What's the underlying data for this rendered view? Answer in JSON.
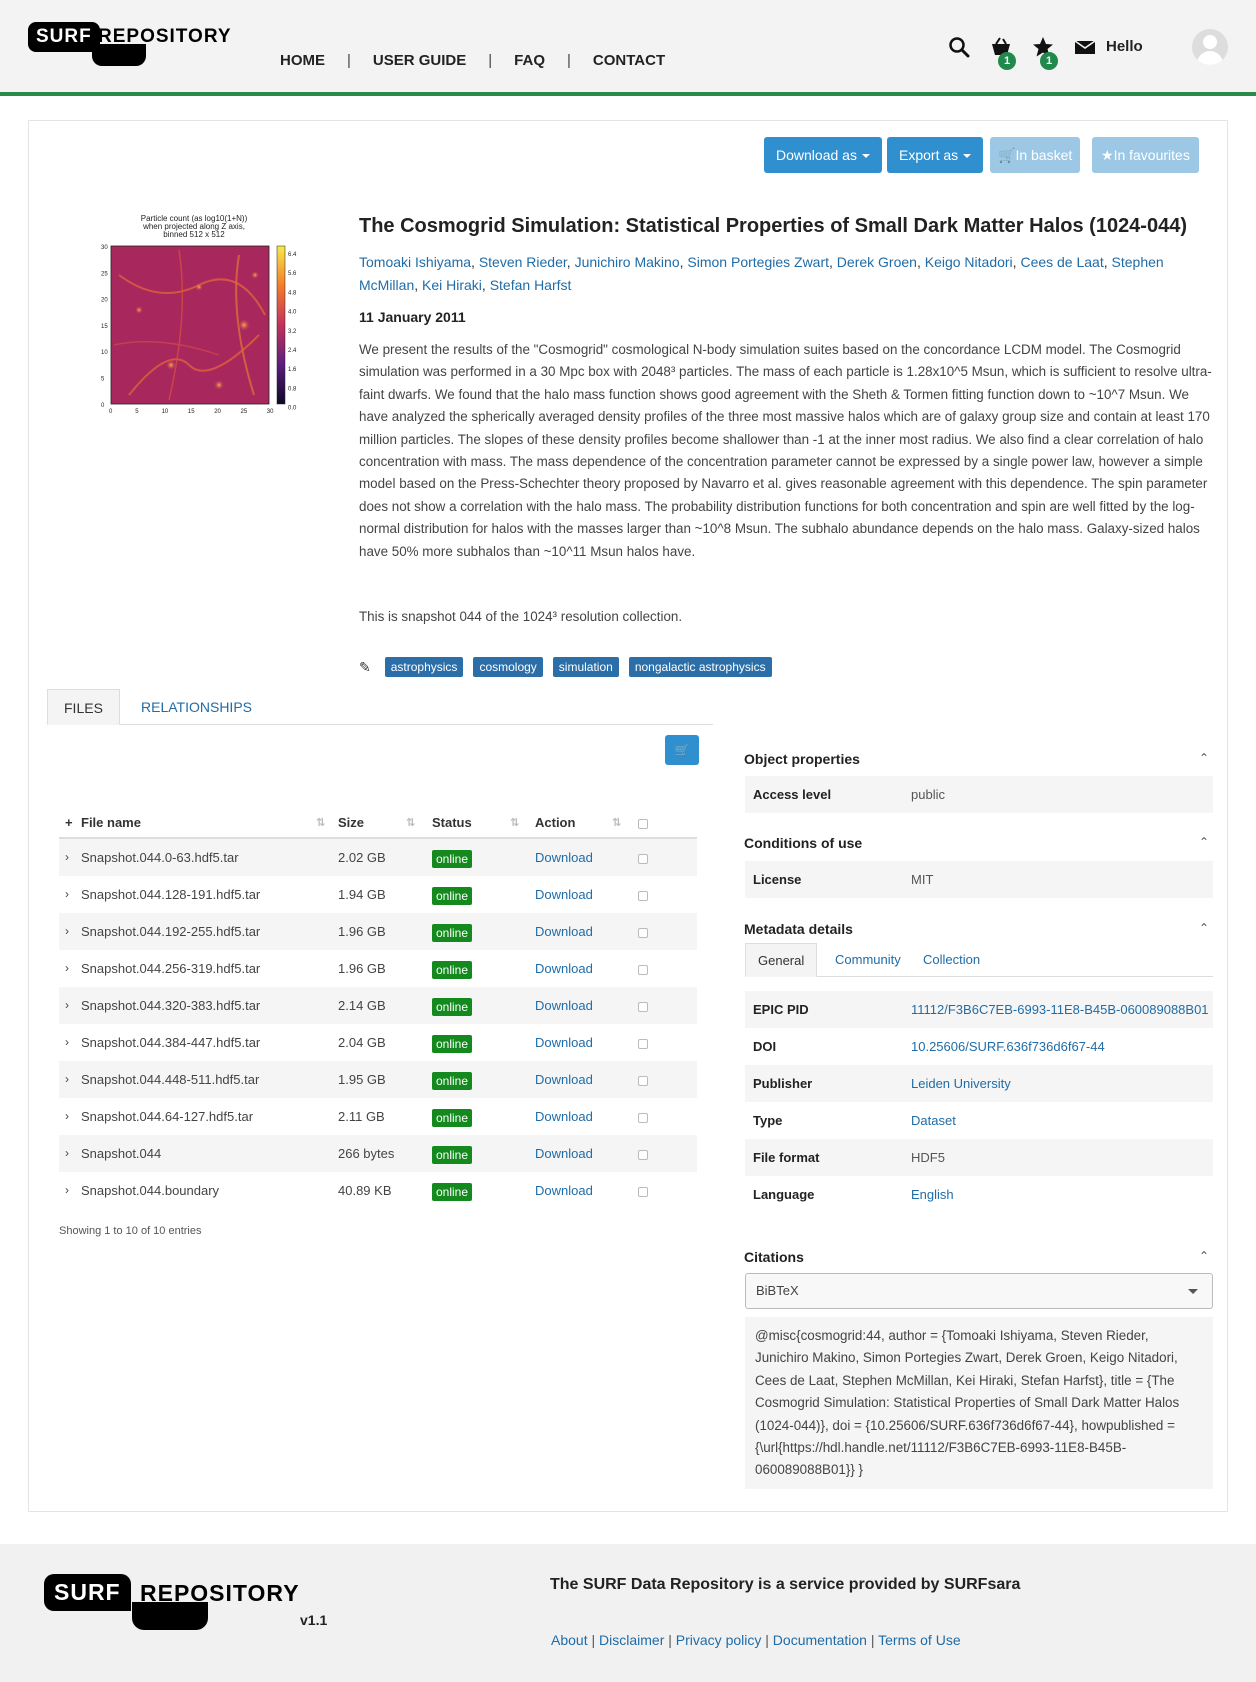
{
  "header": {
    "logo_surf": "SURF",
    "logo_repository": "REPOSITORY",
    "nav": [
      "HOME",
      "USER GUIDE",
      "FAQ",
      "CONTACT"
    ],
    "basket_count": "1",
    "favourites_count": "1",
    "greeting": "Hello"
  },
  "toolbar": {
    "download_as": "Download as",
    "export_as": "Export as",
    "in_basket": "In basket",
    "in_favourites": "In favourites"
  },
  "thumbnail": {
    "title_lines": [
      "Particle count (as log10(1+N))",
      "when projected along Z axis,",
      "binned 512 x 512"
    ],
    "y_ticks": [
      "30",
      "25",
      "20",
      "15",
      "10",
      "5",
      "0"
    ],
    "x_ticks": [
      "0",
      "5",
      "10",
      "15",
      "20",
      "25",
      "30"
    ],
    "colorbar_ticks": [
      "6.4",
      "5.6",
      "4.8",
      "4.0",
      "3.2",
      "2.4",
      "1.6",
      "0.8",
      "0.0"
    ]
  },
  "dataset": {
    "title": "The Cosmogrid Simulation: Statistical Properties of Small Dark Matter Halos (1024-044)",
    "authors": [
      "Tomoaki Ishiyama",
      "Steven Rieder",
      "Junichiro Makino",
      "Simon Portegies Zwart",
      "Derek Groen",
      "Keigo Nitadori",
      "Cees de Laat",
      "Stephen McMillan",
      "Kei Hiraki",
      "Stefan Harfst"
    ],
    "date": "11 January 2011",
    "abstract": "We present the results of the \"Cosmogrid\" cosmological N-body simulation suites based on the concordance LCDM model. The Cosmogrid simulation was performed in a 30 Mpc box with 2048³ particles. The mass of each particle is 1.28x10^5 Msun, which is sufficient to resolve ultra-faint dwarfs. We found that the halo mass function shows good agreement with the Sheth & Tormen fitting function down to ~10^7 Msun. We have analyzed the spherically averaged density profiles of the three most massive halos which are of galaxy group size and contain at least 170 million particles. The slopes of these density profiles become shallower than -1 at the inner most radius. We also find a clear correlation of halo concentration with mass. The mass dependence of the concentration parameter cannot be expressed by a single power law, however a simple model based on the Press-Schechter theory proposed by Navarro et al. gives reasonable agreement with this dependence. The spin parameter does not show a correlation with the halo mass. The probability distribution functions for both concentration and spin are well fitted by the log-normal distribution for halos with the masses larger than ~10^8 Msun. The subhalo abundance depends on the halo mass. Galaxy-sized halos have 50% more subhalos than ~10^11 Msun halos have.",
    "snapshot_note": "This is snapshot 044 of the 1024³ resolution collection.",
    "tags": [
      "astrophysics",
      "cosmology",
      "simulation",
      "nongalactic astrophysics"
    ]
  },
  "files_panel": {
    "tabs": [
      "FILES",
      "RELATIONSHIPS"
    ],
    "columns": {
      "name": "File name",
      "size": "Size",
      "status": "Status",
      "action": "Action"
    },
    "rows": [
      {
        "name": "Snapshot.044.0-63.hdf5.tar",
        "size": "2.02 GB",
        "status": "online",
        "action": "Download"
      },
      {
        "name": "Snapshot.044.128-191.hdf5.tar",
        "size": "1.94 GB",
        "status": "online",
        "action": "Download"
      },
      {
        "name": "Snapshot.044.192-255.hdf5.tar",
        "size": "1.96 GB",
        "status": "online",
        "action": "Download"
      },
      {
        "name": "Snapshot.044.256-319.hdf5.tar",
        "size": "1.96 GB",
        "status": "online",
        "action": "Download"
      },
      {
        "name": "Snapshot.044.320-383.hdf5.tar",
        "size": "2.14 GB",
        "status": "online",
        "action": "Download"
      },
      {
        "name": "Snapshot.044.384-447.hdf5.tar",
        "size": "2.04 GB",
        "status": "online",
        "action": "Download"
      },
      {
        "name": "Snapshot.044.448-511.hdf5.tar",
        "size": "1.95 GB",
        "status": "online",
        "action": "Download"
      },
      {
        "name": "Snapshot.044.64-127.hdf5.tar",
        "size": "2.11 GB",
        "status": "online",
        "action": "Download"
      },
      {
        "name": "Snapshot.044",
        "size": "266 bytes",
        "status": "online",
        "action": "Download"
      },
      {
        "name": "Snapshot.044.boundary",
        "size": "40.89 KB",
        "status": "online",
        "action": "Download"
      }
    ],
    "showing": "Showing 1 to 10 of 10 entries"
  },
  "object_properties": {
    "title": "Object properties",
    "access_level_label": "Access level",
    "access_level": "public"
  },
  "conditions": {
    "title": "Conditions of use",
    "license_label": "License",
    "license": "MIT"
  },
  "metadata": {
    "title": "Metadata details",
    "tabs": [
      "General",
      "Community",
      "Collection"
    ],
    "rows": [
      {
        "label": "EPIC PID",
        "value": "11112/F3B6C7EB-6993-11E8-B45B-060089088B01"
      },
      {
        "label": "DOI",
        "value": "10.25606/SURF.636f736d6f67-44"
      },
      {
        "label": "Publisher",
        "value": "Leiden University"
      },
      {
        "label": "Type",
        "value": "Dataset"
      },
      {
        "label": "File format",
        "value": "HDF5"
      },
      {
        "label": "Language",
        "value": "English"
      }
    ]
  },
  "citations": {
    "title": "Citations",
    "format": "BiBTeX",
    "text": "@misc{cosmogrid:44, author = {Tomoaki Ishiyama, Steven Rieder, Junichiro Makino, Simon Portegies Zwart, Derek Groen, Keigo Nitadori, Cees de Laat, Stephen McMillan, Kei Hiraki, Stefan Harfst}, title = {The Cosmogrid Simulation: Statistical Properties of Small Dark Matter Halos (1024-044)}, doi = {10.25606/SURF.636f736d6f67-44}, howpublished = {\\url{https://hdl.handle.net/11112/F3B6C7EB-6993-11E8-B45B-060089088B01}} }"
  },
  "footer": {
    "logo_surf": "SURF",
    "logo_repository": "REPOSITORY",
    "version": "v1.1",
    "tagline": "The SURF Data Repository is a service provided by SURFsara",
    "links": [
      "About",
      "Disclaimer",
      "Privacy policy",
      "Documentation",
      "Terms of Use"
    ]
  },
  "colors": {
    "accent": "#2f8fcf",
    "link": "#1f6ca8",
    "tag": "#2b6ea8",
    "online": "#148a1e",
    "header_border": "#2a8a4a"
  }
}
